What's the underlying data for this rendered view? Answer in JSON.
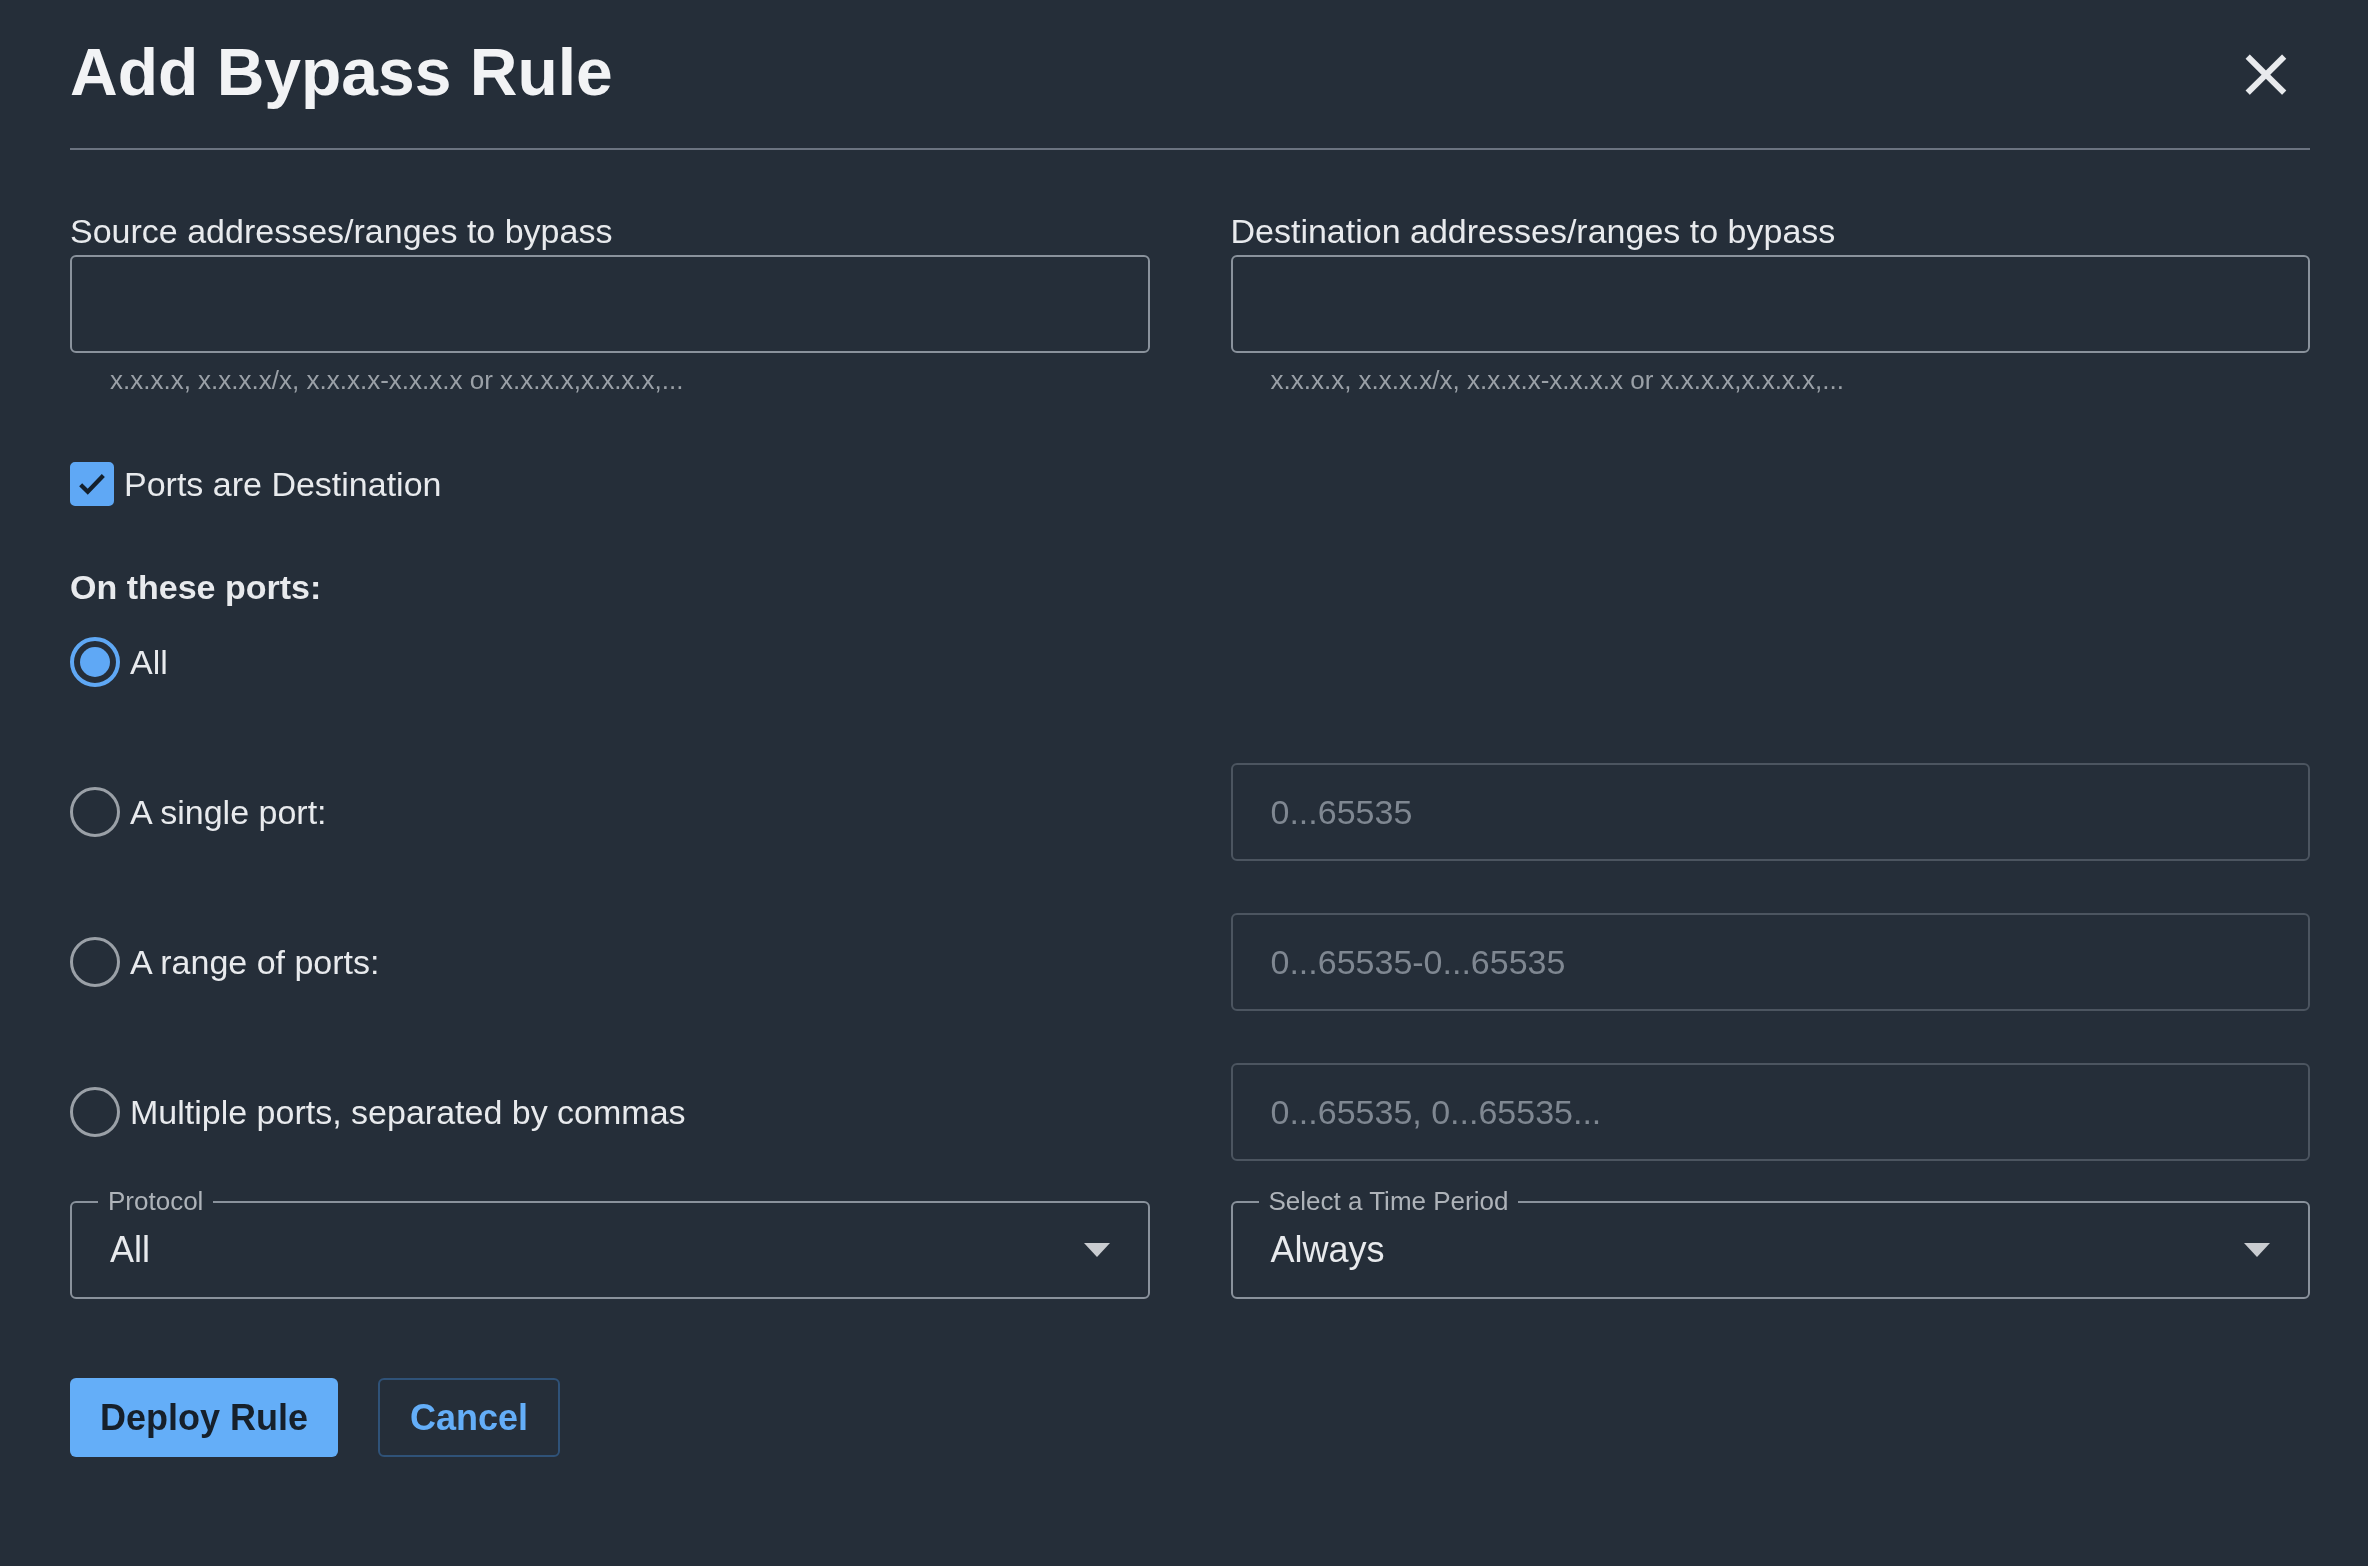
{
  "dialog": {
    "title": "Add Bypass Rule",
    "close": "×"
  },
  "address_fields": [
    {
      "label": "Source addresses/ranges to bypass",
      "hint": "x.x.x.x, x.x.x.x/x, x.x.x.x-x.x.x.x or x.x.x.x,x.x.x.x,..."
    },
    {
      "label": "Destination addresses/ranges to bypass",
      "hint": "x.x.x.x, x.x.x.x/x, x.x.x.x-x.x.x.x or x.x.x.x,x.x.x.x,..."
    }
  ],
  "ports_checkbox": {
    "label": "Ports are Destination",
    "checked": true
  },
  "ports_heading": "On these ports:",
  "port_options": [
    {
      "label": "All",
      "selected": true
    },
    {
      "label": "A single port:",
      "selected": false,
      "placeholder": "0...65535"
    },
    {
      "label": "A range of ports:",
      "selected": false,
      "placeholder": "0...65535-0...65535"
    },
    {
      "label": "Multiple ports, separated by commas",
      "selected": false,
      "placeholder": "0...65535, 0...65535..."
    }
  ],
  "selects": [
    {
      "label": "Protocol",
      "value": "All"
    },
    {
      "label": "Select a Time Period",
      "value": "Always"
    }
  ],
  "buttons": [
    {
      "label": "Deploy Rule",
      "kind": "primary"
    },
    {
      "label": "Cancel",
      "kind": "secondary"
    }
  ]
}
